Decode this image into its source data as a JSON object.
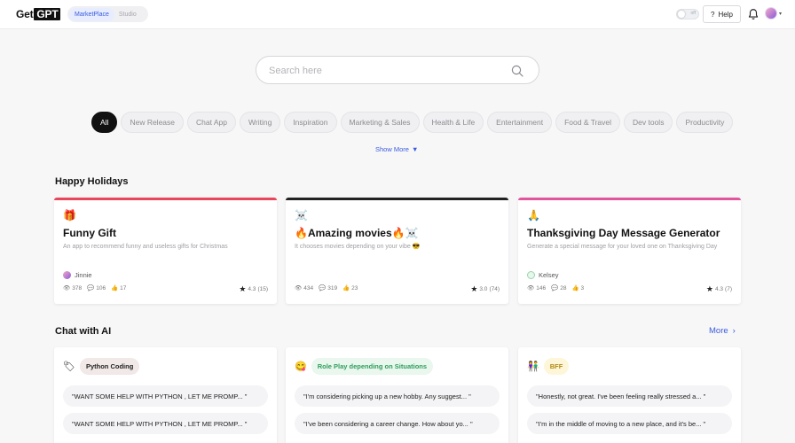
{
  "header": {
    "logo_get": "Get",
    "logo_gpt": "GPT",
    "mode_active": "MarketPlace",
    "mode_inactive": "Studio",
    "switch_label": "off",
    "help_label": "Help"
  },
  "search": {
    "placeholder": "Search here"
  },
  "categories": [
    "All",
    "New Release",
    "Chat App",
    "Writing",
    "Inspiration",
    "Marketing & Sales",
    "Health & Life",
    "Entertainment",
    "Food & Travel",
    "Dev tools",
    "Productivity"
  ],
  "show_more": "Show More",
  "holidays": {
    "title": "Happy Holidays",
    "cards": [
      {
        "emoji": "🎁",
        "title": "Funny Gift",
        "desc": "An app to recommend funny and useless gifts for Christmas",
        "author": "Jinnie",
        "views": "378",
        "comments": "106",
        "likes": "17",
        "rating": "4.3",
        "rating_count": "(15)",
        "accent": "#e8465a"
      },
      {
        "emoji": "☠️",
        "title": "🔥Amazing movies🔥☠️",
        "desc": "It chooses movies depending on your vibe 😎",
        "author": "",
        "views": "434",
        "comments": "319",
        "likes": "23",
        "rating": "3.0",
        "rating_count": "(74)",
        "accent": "#222222"
      },
      {
        "emoji": "🙏",
        "title": "Thanksgiving Day Message Generator",
        "desc": "Generate a special message for your loved one on Thanksgiving Day",
        "author": "Kelsey",
        "views": "146",
        "comments": "28",
        "likes": "3",
        "rating": "4.3",
        "rating_count": "(7)",
        "accent": "#e2559a"
      }
    ]
  },
  "chat": {
    "title": "Chat with AI",
    "more_label": "More",
    "cards": [
      {
        "icon": "🏷",
        "tag": "Python Coding",
        "tag_bg": "#f1e8e8",
        "tag_color": "#222222",
        "prompts": [
          "\"WANT SOME HELP WITH PYTHON , LET ME PROMP... \"",
          "\"WANT SOME HELP WITH PYTHON , LET ME PROMP... \""
        ]
      },
      {
        "icon": "😋",
        "tag": "Role Play depending on Situations",
        "tag_bg": "#e9f7ee",
        "tag_color": "#2f9e5a",
        "prompts": [
          "\"I'm considering picking up a new hobby. Any suggest... \"",
          "\"I've been considering a career change. How about yo... \""
        ]
      },
      {
        "icon": "👫",
        "tag": "BFF",
        "tag_bg": "#fdf6d8",
        "tag_color": "#b08a10",
        "prompts": [
          "\"Honestly, not great. I've been feeling really stressed a... \"",
          "\"I'm in the middle of moving to a new place, and it's be... \""
        ]
      }
    ]
  }
}
